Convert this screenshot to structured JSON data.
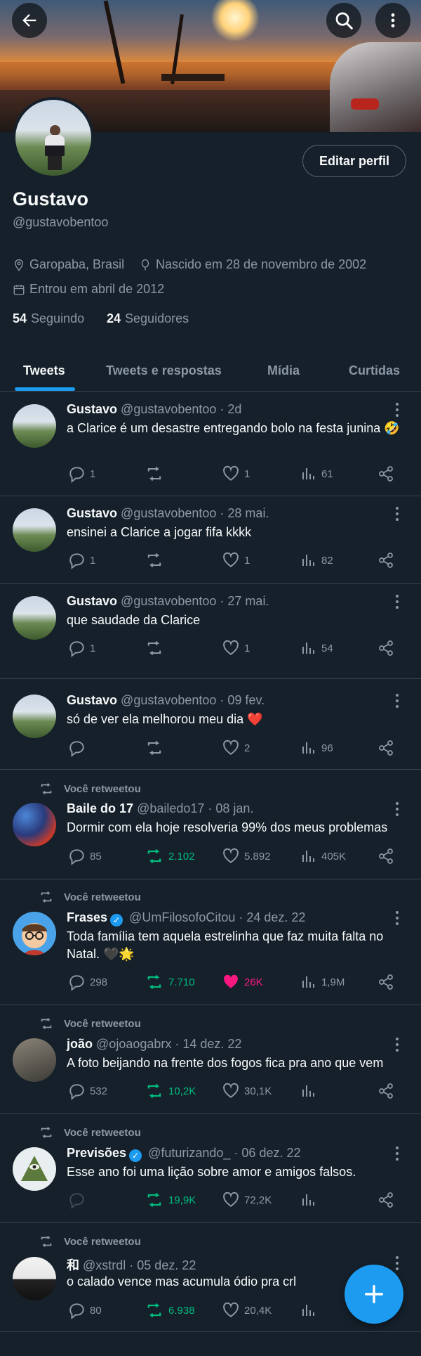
{
  "header": {
    "back_icon": "arrow-left-icon",
    "search_icon": "search-icon",
    "more_icon": "more-vertical-icon"
  },
  "profile": {
    "name": "Gustavo",
    "handle": "@gustavobentoo",
    "edit_label": "Editar perfil",
    "location": "Garopaba, Brasil",
    "birthday": "Nascido em 28 de novembro de 2002",
    "joined": "Entrou em abril de 2012",
    "following_count": "54",
    "following_label": "Seguindo",
    "followers_count": "24",
    "followers_label": "Seguidores"
  },
  "tabs": [
    {
      "label": "Tweets",
      "active": true
    },
    {
      "label": "Tweets e respostas",
      "active": false
    },
    {
      "label": "Mídia",
      "active": false
    },
    {
      "label": "Curtidas",
      "active": false
    }
  ],
  "tweets": [
    {
      "retweet": "",
      "name": "Gustavo",
      "verified": false,
      "meta": "@gustavobentoo · 2d",
      "text": "a Clarice é um desastre entregando bolo na festa junina 🤣",
      "replies": "1",
      "retweets": "",
      "likes": "1",
      "views": "61",
      "liked": false,
      "retweeted": false
    },
    {
      "retweet": "",
      "name": "Gustavo",
      "verified": false,
      "meta": "@gustavobentoo · 28 mai.",
      "text": "ensinei a Clarice a jogar fifa kkkk",
      "replies": "1",
      "retweets": "",
      "likes": "1",
      "views": "82",
      "liked": false,
      "retweeted": false
    },
    {
      "retweet": "",
      "name": "Gustavo",
      "verified": false,
      "meta": "@gustavobentoo · 27 mai.",
      "text": "que saudade da Clarice",
      "replies": "1",
      "retweets": "",
      "likes": "1",
      "views": "54",
      "liked": false,
      "retweeted": false
    },
    {
      "retweet": "",
      "name": "Gustavo",
      "verified": false,
      "meta": "@gustavobentoo · 09 fev.",
      "text": "só de ver ela melhorou meu dia ❤️",
      "replies": "",
      "retweets": "",
      "likes": "2",
      "views": "96",
      "liked": false,
      "retweeted": false
    },
    {
      "retweet": "Você retweetou",
      "name": "Baile do 17",
      "verified": false,
      "meta": "@bailedo17 · 08 jan.",
      "text": "Dormir com ela hoje resolveria 99% dos meus problemas",
      "replies": "85",
      "retweets": "2.102",
      "likes": "5.892",
      "views": "405K",
      "liked": false,
      "retweeted": true
    },
    {
      "retweet": "Você retweetou",
      "name": "Frases",
      "verified": true,
      "meta": "@UmFilosofoCitou · 24 dez. 22",
      "text": "Toda família tem aquela estrelinha que faz muita falta no Natal. 🖤🌟",
      "replies": "298",
      "retweets": "7.710",
      "likes": "26K",
      "views": "1,9M",
      "liked": true,
      "retweeted": true
    },
    {
      "retweet": "Você retweetou",
      "name": "joão",
      "verified": false,
      "meta": "@ojoaogabrx · 14 dez. 22",
      "text": "A foto beijando na frente dos fogos fica pra ano que vem",
      "replies": "532",
      "retweets": "10,2K",
      "likes": "30,1K",
      "views": "",
      "liked": false,
      "retweeted": true
    },
    {
      "retweet": "Você retweetou",
      "name": "Previsões",
      "verified": true,
      "meta": "@futurizando_ · 06 dez. 22",
      "text": "Esse ano foi uma lição sobre amor e amigos falsos.",
      "replies": "",
      "retweets": "19,9K",
      "likes": "72,2K",
      "views": "",
      "liked": false,
      "retweeted": true
    },
    {
      "retweet": "Você retweetou",
      "name": "和",
      "verified": false,
      "meta": "@xstrdl · 05 dez. 22",
      "text": "o calado vence mas acumula ódio pra crl",
      "replies": "80",
      "retweets": "6.938",
      "likes": "20,4K",
      "views": "",
      "liked": false,
      "retweeted": true
    }
  ],
  "fab_icon": "plus-icon",
  "colors": {
    "accent": "#1d9bf0",
    "retweet": "#00ba7c",
    "like": "#f91880",
    "background": "#15202b"
  }
}
